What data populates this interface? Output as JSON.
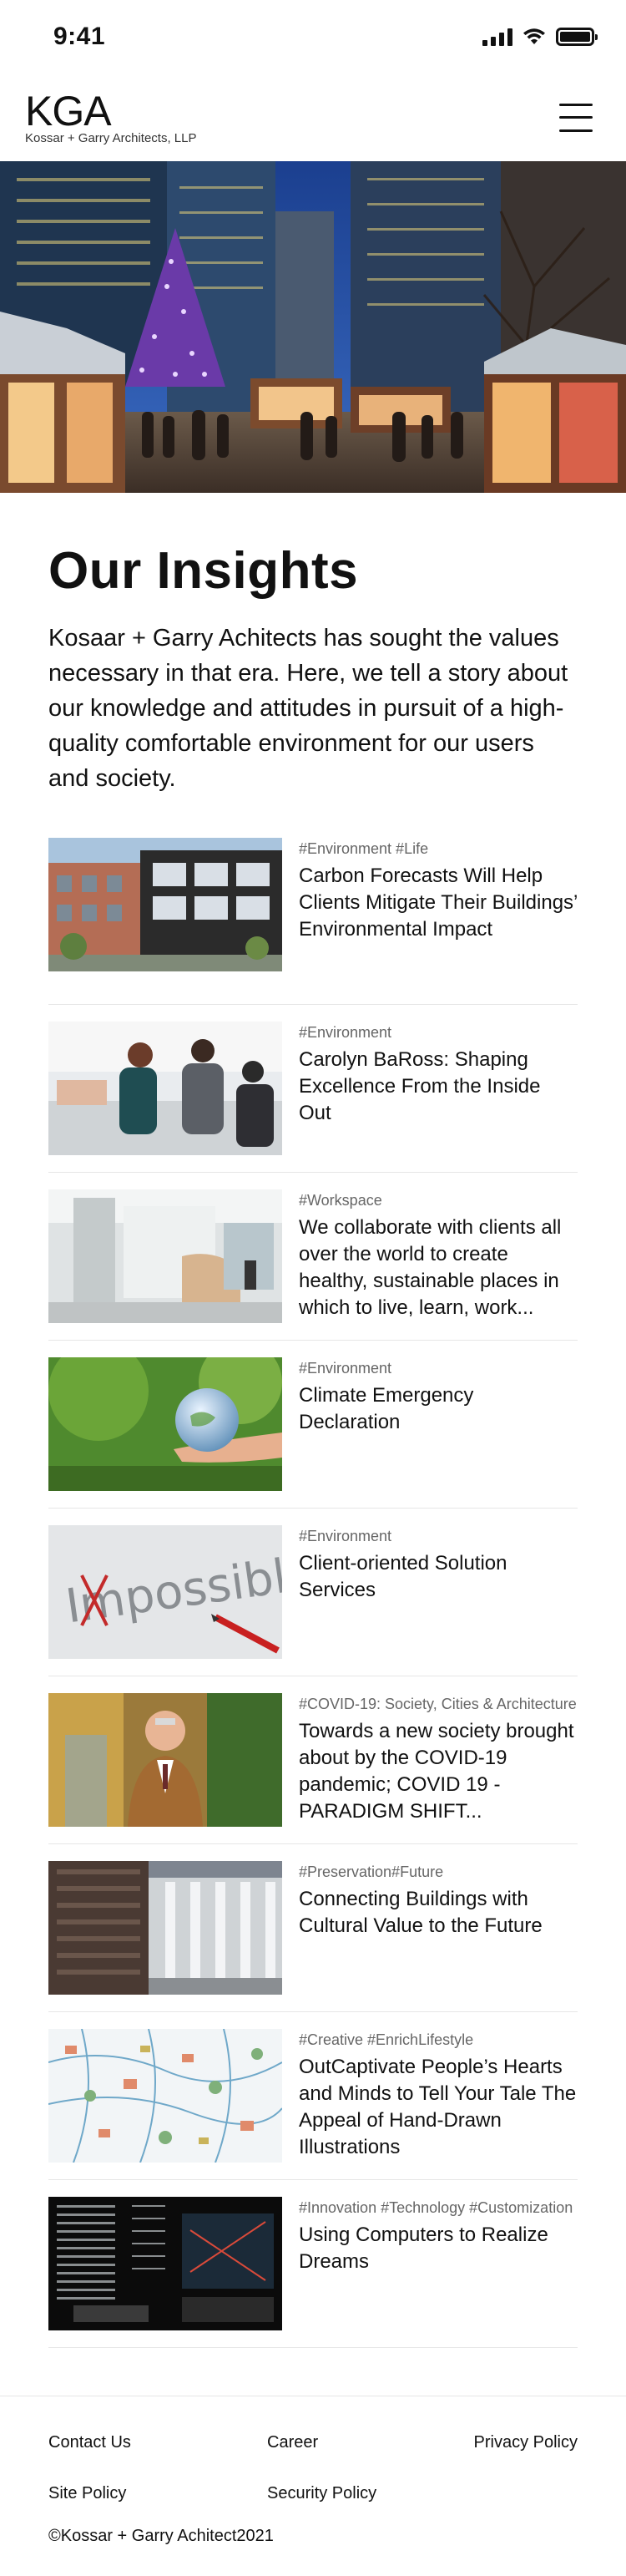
{
  "status_bar": {
    "time": "9:41"
  },
  "header": {
    "logo_mark": "KGA",
    "logo_sub": "Kossar + Garry Architects, LLP"
  },
  "insights": {
    "title": "Our Insights",
    "intro": "Kosaar + Garry Achitects has sought the values necessary in that era. Here, we tell a story about our knowledge and attitudes in pursuit of a high-quality comfortable environment for our users and society.",
    "articles": [
      {
        "tags": "#Environment  #Life",
        "title": "Carbon Forecasts Will Help Clients Mitigate Their Buildings’ Environmental Impact"
      },
      {
        "tags": "#Environment",
        "title": "Carolyn BaRoss: Shaping Excellence From the Inside Out"
      },
      {
        "tags": "#Workspace",
        "title": "We collaborate with clients all over the world to create healthy, sustainable places in which to live, learn, work..."
      },
      {
        "tags": "#Environment",
        "title": "Climate Emergency Declaration"
      },
      {
        "tags": "#Environment",
        "title": "Client-oriented Solution Services"
      },
      {
        "tags": "#COVID-19: Society, Cities & Architecture",
        "title": "Towards a new society brought about by the COVID-19 pandemic; COVID 19 - PARADIGM SHIFT..."
      },
      {
        "tags": "#Preservation#Future",
        "title": "Connecting Buildings with Cultural Value to the Future"
      },
      {
        "tags": "#Creative #EnrichLifestyle",
        "title": "OutCaptivate People’s Hearts and Minds to Tell Your Tale The Appeal of Hand-Drawn Illustrations"
      },
      {
        "tags": "#Innovation #Technology #Customization",
        "title": "Using Computers to Realize Dreams"
      }
    ]
  },
  "footer": {
    "links": [
      "Contact Us",
      "Career",
      "Privacy Policy",
      "Site Policy",
      "Security Policy"
    ],
    "copyright": "©Kossar + Garry Achitect2021"
  }
}
